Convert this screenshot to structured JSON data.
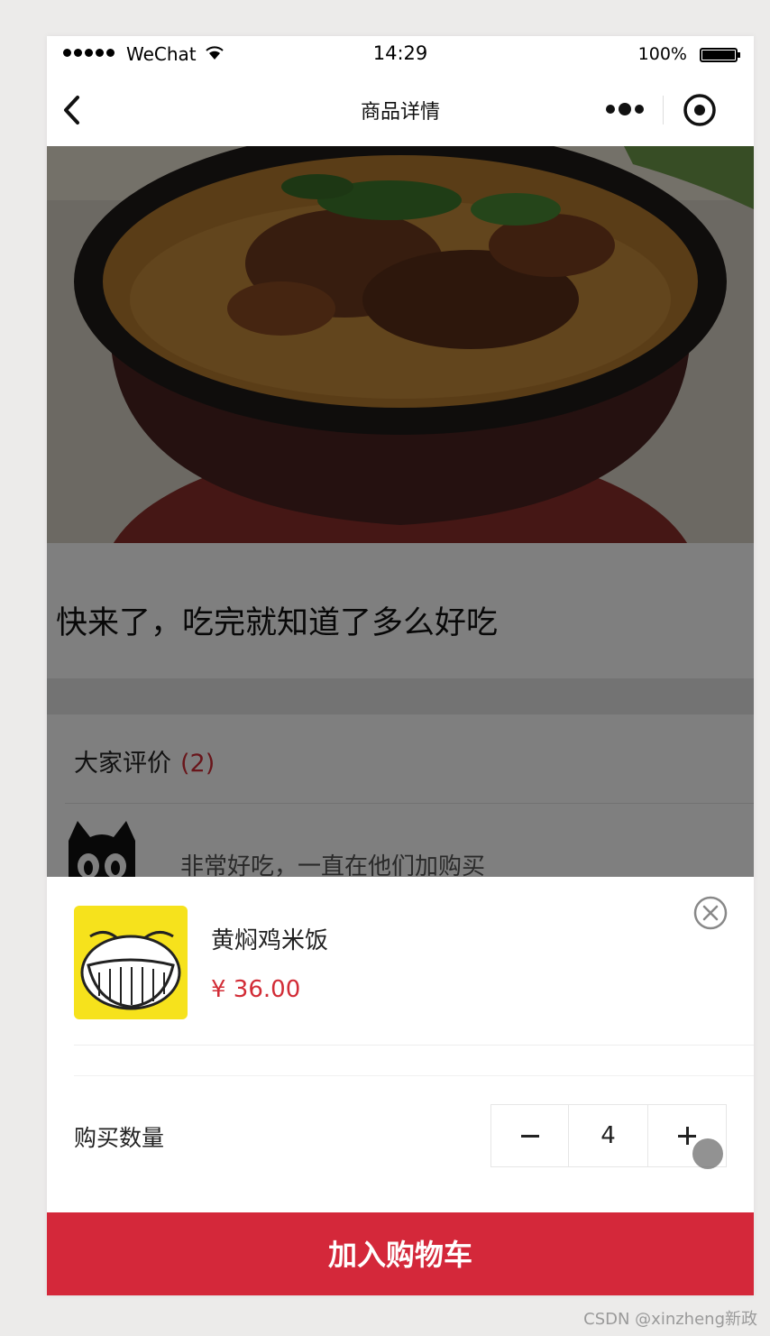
{
  "status_bar": {
    "carrier": "WeChat",
    "time": "14:29",
    "battery": "100%",
    "wifi_icon": "wifi-icon",
    "battery_icon": "battery-icon"
  },
  "nav": {
    "title": "商品详情",
    "back_icon": "chevron-left-icon",
    "more_icon": "more-dots-icon",
    "close_icon": "target-circle-icon"
  },
  "product": {
    "description": "快来了，吃完就知道了多么好吃",
    "image_icon": "food-photo"
  },
  "reviews": {
    "label": "大家评价",
    "count": "(2)",
    "items": [
      {
        "avatar_icon": "cat-avatar-icon",
        "text": "非常好吃，一直在他们加购买"
      }
    ]
  },
  "cart_sheet": {
    "name": "黄焖鸡米饭",
    "price": "¥ 36.00",
    "quantity_label": "购买数量",
    "quantity": "4",
    "minus_icon": "minus-icon",
    "plus_icon": "plus-icon",
    "close_icon": "close-circle-icon",
    "add_button": "加入购物车"
  },
  "colors": {
    "accent": "#d4283a",
    "price": "#d22c36",
    "thumb_bg": "#f6e21c"
  },
  "watermark": "CSDN @xinzheng新政"
}
